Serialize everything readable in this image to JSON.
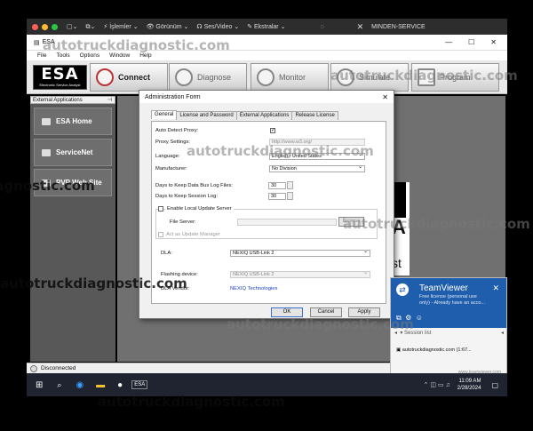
{
  "mac_menu": {
    "items": [
      "İşlemler",
      "Görünüm",
      "Ses/Video",
      "Ekstralar"
    ],
    "session": "MINDEN-SERVICE"
  },
  "window": {
    "title": "ESA",
    "menu": [
      "File",
      "Tools",
      "Options",
      "Window",
      "Help"
    ]
  },
  "toolbar": {
    "logo_title": "ESA",
    "logo_sub": "Electronic Service Analyst",
    "buttons": [
      "Connect",
      "Diagnose",
      "Monitor",
      "Simulate",
      "Program"
    ]
  },
  "sidebar": {
    "header": "External Applications",
    "pin": "ᵖ",
    "items": [
      "ESA Home",
      "ServiceNet",
      "PVP Web Site"
    ]
  },
  "dialog": {
    "title": "Administration Form",
    "tabs": [
      "General",
      "License and Password",
      "External Applications",
      "Release License"
    ],
    "labels": {
      "auto_detect": "Auto Detect Proxy:",
      "proxy_settings": "Proxy Settings:",
      "language": "Language:",
      "manufacturer": "Manufacturer:",
      "days_data_bus": "Days to Keep Data Bus Log Files:",
      "days_session": "Days to Keep Session Log:",
      "enable_local": "Enable Local Update Server",
      "file_server": "File Server:",
      "act_as": "Act as Update Manager",
      "dla": "DLA:",
      "flashing": "Flashing device:",
      "dla_vendor": "DLA Vendor:"
    },
    "values": {
      "proxy": "http://www.w3.org/",
      "language": "English - United States",
      "manufacturer": "No Division",
      "days_data_bus": "30",
      "days_session": "30",
      "dla": "NEXIQ USB-Link 2",
      "flashing": "NEXIQ USB-Link 2",
      "dla_vendor": "NEXIQ Technologies",
      "auto_detect_check": "✓"
    },
    "buttons": {
      "browse": "Browse",
      "ok": "OK",
      "cancel": "Cancel",
      "apply": "Apply"
    }
  },
  "background_text": {
    "big": "A",
    "st": "st"
  },
  "status": {
    "text": "Disconnected"
  },
  "teamviewer": {
    "title": "TeamViewer",
    "line1": "Free license (personal use",
    "line2": "only) - Already have an acco...",
    "session_list": "Session list",
    "item": "autotruckdiagnostic.com (1:67...",
    "footer": "www.teamviewer.com"
  },
  "taskbar": {
    "time": "11:09 AM",
    "date": "2/28/2024"
  },
  "watermark": "autotruckdiagnostic.com",
  "colors": {
    "tv_blue": "#1f5eac",
    "sidebar": "#585858",
    "link": "#1a3fc2"
  }
}
